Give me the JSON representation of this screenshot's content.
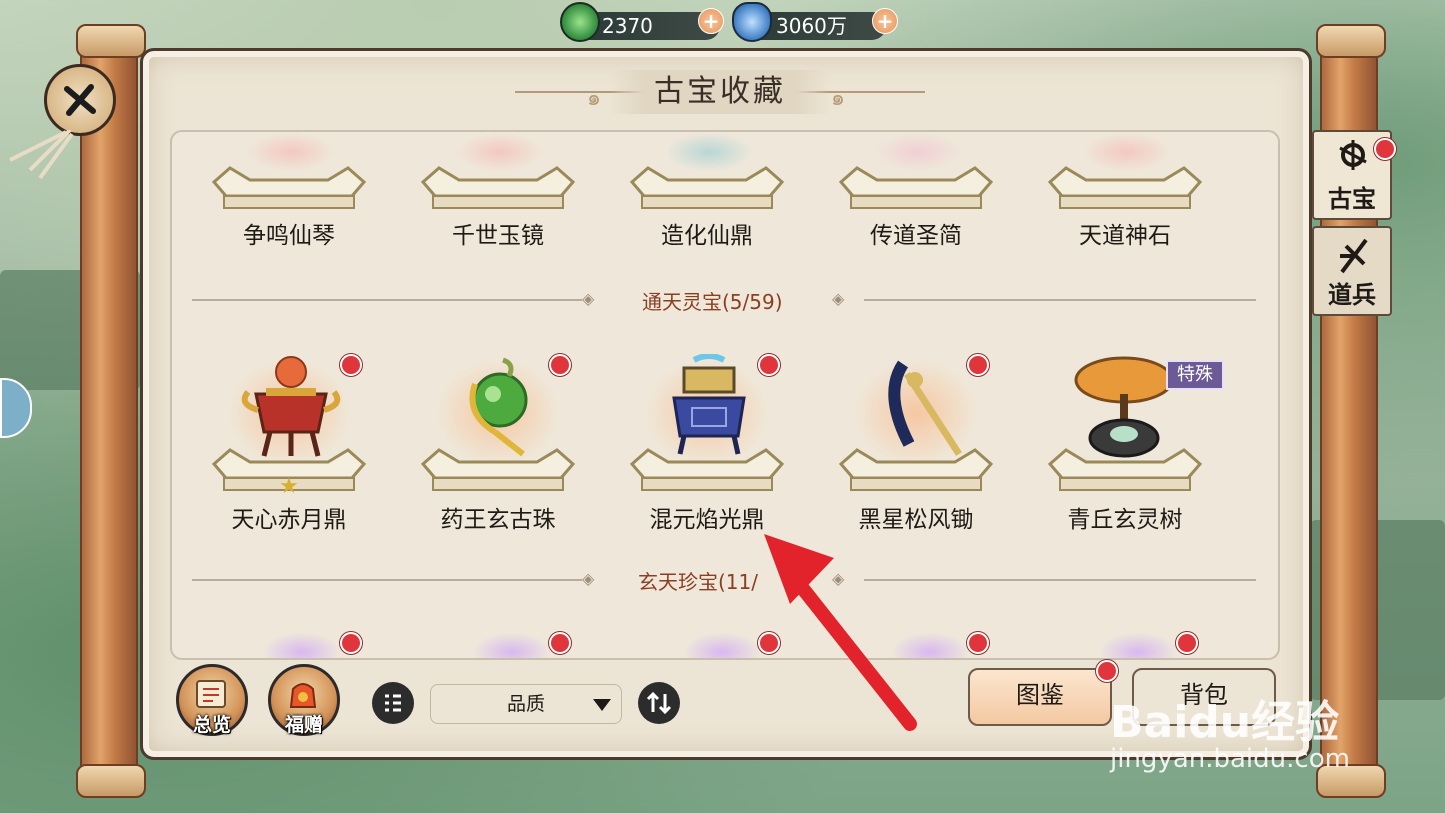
{
  "currency": {
    "jade_value": "2370",
    "crystal_value": "3060万",
    "plus_symbol": "+"
  },
  "title": "古宝收藏",
  "rows": {
    "top": [
      {
        "name": "争鸣仙琴"
      },
      {
        "name": "千世玉镜"
      },
      {
        "name": "造化仙鼎"
      },
      {
        "name": "传道圣简"
      },
      {
        "name": "天道神石"
      }
    ],
    "tongtian": [
      {
        "name": "天心赤月鼎",
        "star": "★"
      },
      {
        "name": "药王玄古珠"
      },
      {
        "name": "混元焰光鼎"
      },
      {
        "name": "黑星松风锄"
      },
      {
        "name": "青丘玄灵树",
        "badge": "特殊"
      }
    ]
  },
  "sections": {
    "tongtian_label": "通天灵宝(5/59)",
    "xuantian_label": "玄天珍宝(11/"
  },
  "side_tabs": {
    "gubao": "古宝",
    "daobing": "道兵"
  },
  "bottom": {
    "overview": "总览",
    "gift": "福赠",
    "filter_value": "品质",
    "catalog": "图鉴",
    "bag": "背包"
  },
  "watermark": {
    "brand": "Baidu经验",
    "url": "jingyan.baidu.com"
  },
  "colors": {
    "accent_red": "#e0353a",
    "section_text": "#8a3e22",
    "annotation_arrow": "#e3232b"
  }
}
